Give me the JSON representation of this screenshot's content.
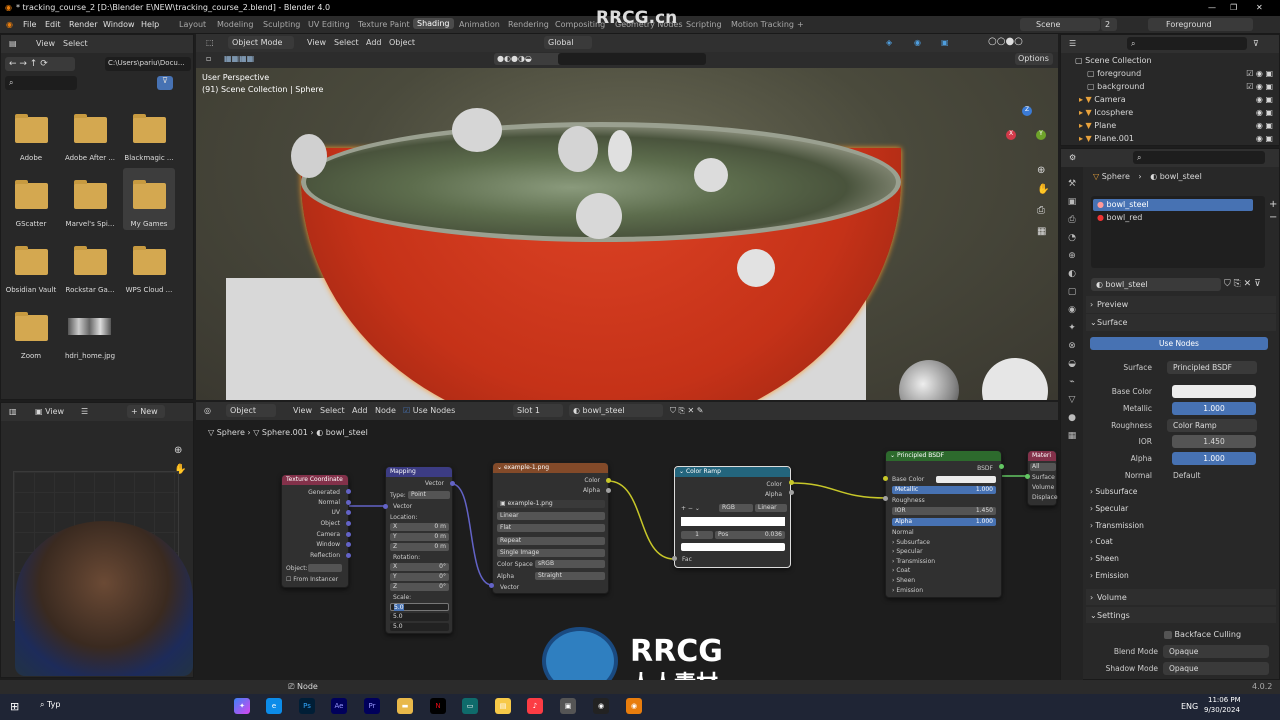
{
  "title": "* tracking_course_2 [D:\\Blender E\\NEW\\tracking_course_2.blend] - Blender 4.0",
  "menu": [
    "File",
    "Edit",
    "Render",
    "Window",
    "Help"
  ],
  "workspaces": [
    "Layout",
    "Modeling",
    "Sculpting",
    "UV Editing",
    "Texture Paint",
    "Shading",
    "Animation",
    "Rendering",
    "Compositing",
    "Geometry Nodes",
    "Scripting",
    "Motion Tracking"
  ],
  "active_workspace": "Shading",
  "scene": "Scene",
  "scene_count": "2",
  "view_layer": "Foreground",
  "file_browser": {
    "view": "View",
    "select": "Select",
    "path": "C:\\Users\\pariu\\Docu...",
    "folders": [
      "Adobe",
      "Adobe After ...",
      "Blackmagic ...",
      "GScatter",
      "Marvel's Spi...",
      "My Games",
      "Obsidian Vault",
      "Rockstar Ga...",
      "WPS Cloud ...",
      "Zoom",
      "hdri_home.jpg"
    ]
  },
  "viewport": {
    "mode": "Object Mode",
    "view": "View",
    "select": "Select",
    "add": "Add",
    "object": "Object",
    "orientation": "Global",
    "options": "Options",
    "info1": "User Perspective",
    "info2": "(91) Scene Collection | Sphere"
  },
  "outliner": {
    "root": "Scene Collection",
    "items": [
      "foreground",
      "background",
      "Camera",
      "Icosphere",
      "Plane",
      "Plane.001"
    ]
  },
  "properties": {
    "breadcrumb_obj": "Sphere",
    "breadcrumb_mat": "bowl_steel",
    "materials": [
      "bowl_steel",
      "bowl_red"
    ],
    "material_name": "bowl_steel",
    "preview": "Preview",
    "surface_sec": "Surface",
    "use_nodes": "Use Nodes",
    "surface_label": "Surface",
    "surface_val": "Principled BSDF",
    "base_color_label": "Base Color",
    "metallic_label": "Metallic",
    "metallic": "1.000",
    "roughness_label": "Roughness",
    "roughness_val": "Color Ramp",
    "ior_label": "IOR",
    "ior": "1.450",
    "alpha_label": "Alpha",
    "alpha": "1.000",
    "normal_label": "Normal",
    "normal_val": "Default",
    "subsections": [
      "Subsurface",
      "Specular",
      "Transmission",
      "Coat",
      "Sheen",
      "Emission"
    ],
    "volume": "Volume",
    "settings": "Settings",
    "backface": "Backface Culling",
    "blend_label": "Blend Mode",
    "blend_val": "Opaque",
    "shadow_label": "Shadow Mode",
    "shadow_val": "Opaque"
  },
  "node_editor": {
    "object": "Object",
    "view": "View",
    "select": "Select",
    "add": "Add",
    "node": "Node",
    "use_nodes": "Use Nodes",
    "slot": "Slot 1",
    "material": "bowl_steel",
    "crumbs": [
      "Sphere",
      "Sphere.001",
      "bowl_steel"
    ],
    "texcoord": {
      "title": "Texture Coordinate",
      "outputs": [
        "Generated",
        "Normal",
        "UV",
        "Object",
        "Camera",
        "Window",
        "Reflection"
      ],
      "object": "Object:",
      "instancer": "From Instancer"
    },
    "mapping": {
      "title": "Mapping",
      "out": "Vector",
      "type_label": "Type:",
      "type": "Point",
      "vector": "Vector",
      "location": "Location:",
      "loc": [
        "0 m",
        "0 m",
        "0 m"
      ],
      "rotation": "Rotation:",
      "rot": [
        "0°",
        "0°",
        "0°"
      ],
      "scale": "Scale:",
      "scl": [
        "5.0",
        "5.0",
        "5.0"
      ],
      "axes": [
        "X",
        "Y",
        "Z"
      ]
    },
    "image": {
      "title": "example-1.png",
      "outs": [
        "Color",
        "Alpha"
      ],
      "file": "example-1.png",
      "opts": [
        "Linear",
        "Flat",
        "Repeat",
        "Single Image"
      ],
      "cs_label": "Color Space",
      "cs": "sRGB",
      "alpha_label": "Alpha",
      "alpha": "Straight",
      "vector": "Vector"
    },
    "ramp": {
      "title": "Color Ramp",
      "outs": [
        "Color",
        "Alpha"
      ],
      "mode": "RGB",
      "interp": "Linear",
      "idx": "1",
      "pos_label": "Pos",
      "pos": "0.036",
      "fac": "Fac"
    },
    "bsdf": {
      "title": "Principled BSDF",
      "out": "BSDF",
      "rows": [
        "Base Color",
        "Metallic",
        "Roughness",
        "IOR",
        "Alpha",
        "Normal"
      ],
      "metallic": "1.000",
      "ior": "1.450",
      "alpha": "1.000",
      "subs": [
        "Subsurface",
        "Specular",
        "Transmission",
        "Coat",
        "Sheen",
        "Emission"
      ]
    },
    "output": {
      "title": "Materi",
      "target": "All",
      "ins": [
        "Surface",
        "Volume",
        "Displacen"
      ]
    }
  },
  "status": {
    "node": "Node",
    "version": "4.0.2"
  },
  "taskbar": {
    "search": "Typ",
    "time": "11:06 PM",
    "date": "9/30/2024",
    "lang": "ENG"
  },
  "watermark": "RRCG.cn",
  "brand": {
    "rrcg": "RRCG",
    "cn_text": "人人素材"
  }
}
